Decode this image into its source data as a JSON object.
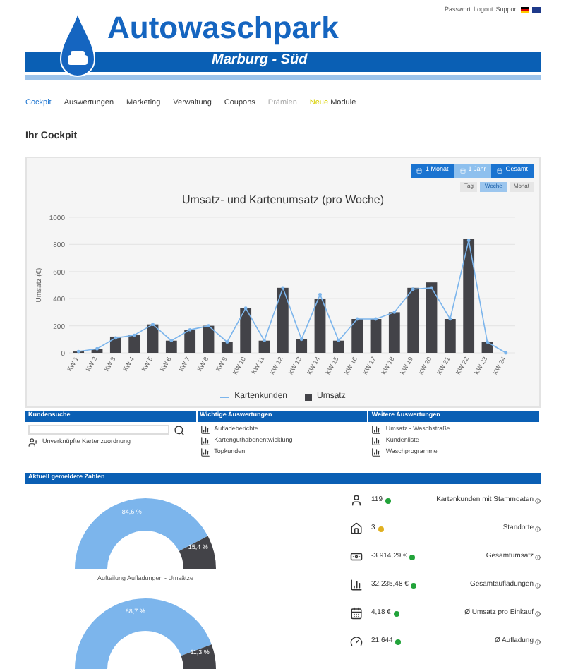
{
  "top_links": [
    "Passwort",
    "Logout",
    "Support"
  ],
  "logo": {
    "title": "Autowaschpark",
    "subtitle": "Marburg - Süd"
  },
  "nav": [
    {
      "label": "Cockpit",
      "selected": true
    },
    {
      "label": "Auswertungen",
      "selected": false
    },
    {
      "label": "Marketing",
      "selected": false
    },
    {
      "label": "Verwaltung",
      "selected": false
    },
    {
      "label": "Coupons",
      "selected": false
    },
    {
      "label": "Prämien",
      "selected": false,
      "disabled": true
    },
    {
      "badge": "Neue",
      "label": "Module",
      "selected": false
    }
  ],
  "page_title": "Ihr Cockpit",
  "range_buttons": [
    {
      "label": "1 Monat",
      "selected": false
    },
    {
      "label": "1 Jahr",
      "selected": true
    },
    {
      "label": "Gesamt",
      "selected": false
    }
  ],
  "period_buttons": [
    {
      "label": "Tag",
      "selected": false
    },
    {
      "label": "Woche",
      "selected": true
    },
    {
      "label": "Monat",
      "selected": false
    }
  ],
  "chart_data": {
    "type": "bar",
    "grid": true,
    "legend": "bottom",
    "title": "Umsatz- und Kartenumsatz (pro Woche)",
    "ylabel": "Umsatz (€)",
    "yticks": [
      0,
      200,
      400,
      600,
      800,
      1000
    ],
    "ylim": [
      0,
      1000
    ],
    "categories": [
      "KW 1",
      "KW 2",
      "KW 3",
      "KW 4",
      "KW 5",
      "KW 6",
      "KW 7",
      "KW 8",
      "KW 9",
      "KW 10",
      "KW 11",
      "KW 12",
      "KW 13",
      "KW 14",
      "KW 15",
      "KW 16",
      "KW 17",
      "KW 18",
      "KW 19",
      "KW 20",
      "KW 21",
      "KW 22",
      "KW 23",
      "KW 24"
    ],
    "series": [
      {
        "name": "Kartenkunden",
        "type": "line",
        "color": "#7cb5ec",
        "values": [
          10,
          30,
          110,
          130,
          210,
          90,
          170,
          200,
          80,
          330,
          90,
          480,
          100,
          430,
          90,
          250,
          250,
          300,
          470,
          480,
          250,
          830,
          80,
          0
        ]
      },
      {
        "name": "Umsatz",
        "type": "bar",
        "color": "#434348",
        "values": [
          10,
          30,
          120,
          130,
          210,
          90,
          170,
          200,
          80,
          330,
          90,
          480,
          100,
          400,
          90,
          250,
          250,
          300,
          480,
          520,
          250,
          840,
          80,
          0
        ]
      }
    ]
  },
  "panels": [
    {
      "title": "Kundensuche",
      "kind": "search",
      "links": [
        {
          "label": "Unverknüpfte Kartenzuordnung"
        }
      ]
    },
    {
      "title": "Wichtige Auswertungen",
      "links": [
        {
          "label": "Aufladeberichte"
        },
        {
          "label": "Kartenguthabenentwicklung"
        },
        {
          "label": "Topkunden"
        }
      ]
    },
    {
      "title": "Weitere Auswertungen",
      "links": [
        {
          "label": "Umsatz - Waschstraße"
        },
        {
          "label": "Kundenliste"
        },
        {
          "label": "Waschprogramme"
        }
      ]
    }
  ],
  "numbers_title": "Aktuell gemeldete Zahlen",
  "gauges": [
    {
      "chart_data": {
        "type": "donut",
        "title": "Aufteilung Aufladungen - Umsätze",
        "values": [
          84.6,
          15.4
        ],
        "value_labels": [
          "84,6 %",
          "15,4 %"
        ]
      }
    },
    {
      "chart_data": {
        "type": "donut",
        "values": [
          88.7,
          11.3
        ],
        "value_labels": [
          "88,7 %",
          "11,3 %"
        ]
      }
    }
  ],
  "stats": [
    {
      "kind": "user",
      "value": "119",
      "color": "#22a33a",
      "label": "Kartenkunden mit Stammdaten"
    },
    {
      "kind": "home",
      "value": "3",
      "color": "#e0b020",
      "label": "Standorte"
    },
    {
      "kind": "money",
      "value": "-3.914,29 €",
      "color": "#22a33a",
      "label": "Gesamtumsatz"
    },
    {
      "kind": "chart",
      "value": "32.235,48 €",
      "color": "#22a33a",
      "label": "Gesamtaufladungen"
    },
    {
      "kind": "calendar",
      "value": "4,18 €",
      "color": "#22a33a",
      "label": "Ø Umsatz pro Einkauf"
    },
    {
      "kind": "gauge",
      "value": "21.644",
      "color": "#22a33a",
      "label": "Ø Aufladung"
    }
  ]
}
